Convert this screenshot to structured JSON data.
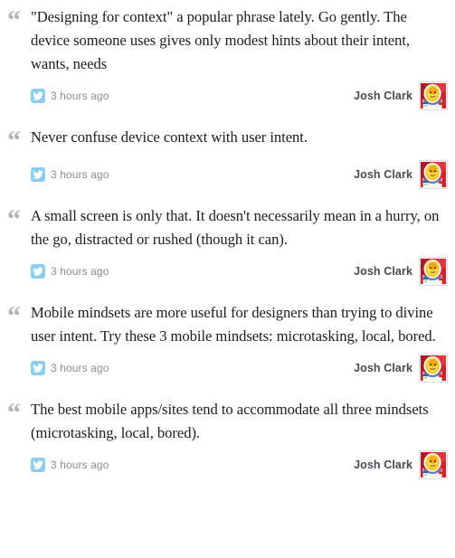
{
  "feed": {
    "author_name": "Josh Clark",
    "quote_glyph": "“",
    "source_icon": "twitter-bird-icon",
    "avatar_icon": "astronaut-avatar-icon",
    "entries": [
      {
        "text": "\"Designing for context\" a popular phrase lately. Go gently. The device someone uses gives only modest hints about their intent, wants, needs",
        "timestamp": "3 hours ago",
        "author": "Josh Clark"
      },
      {
        "text": "Never confuse device context with user intent.",
        "timestamp": "3 hours ago",
        "author": "Josh Clark"
      },
      {
        "text": "A small screen is only that. It doesn't necessarily mean in a hurry, on the go, distracted or rushed (though it can).",
        "timestamp": "3 hours ago",
        "author": "Josh Clark"
      },
      {
        "text": "Mobile mindsets are more useful for designers than trying to divine user intent. Try these 3 mobile mindsets: microtasking, local, bored.",
        "timestamp": "3 hours ago",
        "author": "Josh Clark"
      },
      {
        "text": "The best mobile apps/sites tend to accommodate all three mindsets (microtasking, local, bored).",
        "timestamp": "3 hours ago",
        "author": "Josh Clark"
      }
    ]
  },
  "colors": {
    "background": "#ffffff",
    "quote_text": "#1d1d1d",
    "quote_mark": "#b0b3b8",
    "timestamp": "#8d8d8d",
    "author": "#4a4a52",
    "twitter_badge": "#8fcdec",
    "avatar_border": "#dcdcdc",
    "avatar_background_red": "#d5202a",
    "avatar_face_yellow": "#f5c518"
  }
}
